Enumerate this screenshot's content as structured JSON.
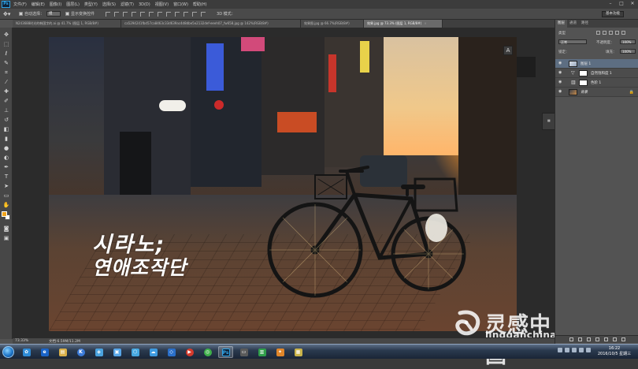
{
  "app": {
    "logo": "Ps",
    "menus": [
      "文件(F)",
      "编辑(E)",
      "图像(I)",
      "图层(L)",
      "类型(Y)",
      "选择(S)",
      "滤镜(T)",
      "3D(D)",
      "视图(V)",
      "窗口(W)",
      "帮助(H)"
    ]
  },
  "options": {
    "auto_select_label": "自动选择：",
    "auto_select_value": "组",
    "show_transform_label": "显示变换控件",
    "mode3d_label": "3D 模式：",
    "workspace": "基本功能"
  },
  "tabs": [
    {
      "label": "N243688时光的韩国字的.ai @ 41.7% (图层 1, RGB/8#)",
      "active": false
    },
    {
      "label": "ca5294241fbd57ca8463c33d639ac4d8dbe5e2132def-eeeh07_fw658.jpg @ 142%(RGB/8#)",
      "active": false
    },
    {
      "label": "效果图.jpg @ 66.7%(RGB/8#)",
      "active": false
    },
    {
      "label": "效果.jpg @ 73.3% (图层 1, RGB/8#)",
      "active": true
    }
  ],
  "canvas": {
    "calligraphy_line1": "시라노;",
    "calligraphy_line2": "연애조작단",
    "watermark_cn": "灵感中国",
    "watermark_en": "lingganchina.com"
  },
  "status": {
    "zoom": "73.33%",
    "doc": "文档:6.59M/11.2M"
  },
  "layers_panel": {
    "tabs": [
      "图层",
      "通道",
      "路径"
    ],
    "kind_label": "类型",
    "blend_mode": "正常",
    "opacity_label": "不透明度：",
    "opacity_value": "100%",
    "lock_label": "锁定：",
    "fill_label": "填充：",
    "fill_value": "100%",
    "layers": [
      {
        "name": "图层 1",
        "selected": true,
        "type": "pixel"
      },
      {
        "name": "自然饱和度 1",
        "selected": false,
        "type": "adjust"
      },
      {
        "name": "色阶 1",
        "selected": false,
        "type": "adjust"
      },
      {
        "name": "背景",
        "selected": false,
        "type": "bg"
      }
    ]
  },
  "taskbar": {
    "time": "16:22",
    "date": "2016/10/5 星期三"
  }
}
